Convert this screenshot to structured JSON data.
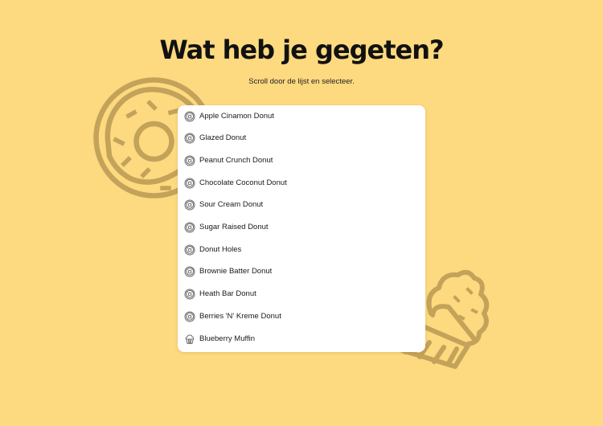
{
  "page": {
    "title": "Wat heb je gegeten?",
    "subtitle": "Scroll door de lijst en selecteer."
  },
  "colors": {
    "background": "#fdd97f",
    "art": "#c3a35a",
    "card": "#ffffff",
    "text": "#111111"
  },
  "list": {
    "items": [
      {
        "label": "Apple Cinamon Donut",
        "icon": "donut-icon"
      },
      {
        "label": "Glazed Donut",
        "icon": "donut-icon"
      },
      {
        "label": "Peanut Crunch Donut",
        "icon": "donut-icon"
      },
      {
        "label": "Chocolate Coconut Donut",
        "icon": "donut-icon"
      },
      {
        "label": "Sour Cream Donut",
        "icon": "donut-icon"
      },
      {
        "label": "Sugar Raised Donut",
        "icon": "donut-icon"
      },
      {
        "label": "Donut Holes",
        "icon": "donut-icon"
      },
      {
        "label": "Brownie Batter Donut",
        "icon": "donut-icon"
      },
      {
        "label": "Heath Bar Donut",
        "icon": "donut-icon"
      },
      {
        "label": "Berries 'N' Kreme Donut",
        "icon": "donut-icon"
      },
      {
        "label": "Blueberry Muffin",
        "icon": "muffin-icon"
      }
    ]
  }
}
